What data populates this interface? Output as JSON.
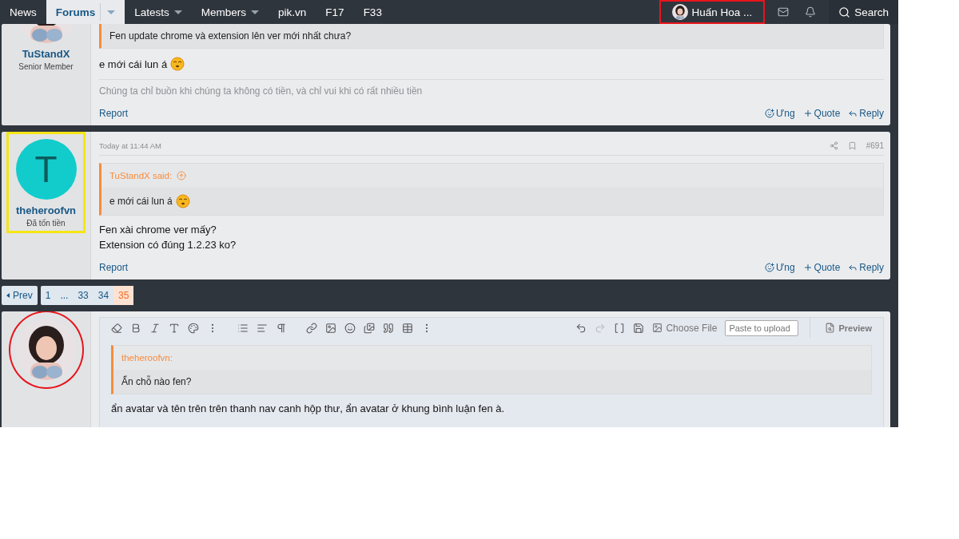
{
  "nav": {
    "items": [
      {
        "label": "News",
        "selected": false,
        "dropdown": false
      },
      {
        "label": "Forums",
        "selected": true,
        "dropdown": true
      },
      {
        "label": "Latests",
        "selected": false,
        "dropdown": true
      },
      {
        "label": "Members",
        "selected": false,
        "dropdown": true
      },
      {
        "label": "pik.vn",
        "selected": false,
        "dropdown": false
      },
      {
        "label": "F17",
        "selected": false,
        "dropdown": false
      },
      {
        "label": "F33",
        "selected": false,
        "dropdown": false
      }
    ],
    "user_menu": {
      "name": "Huấn Hoa ...",
      "highlight": {
        "color": "#e8141c"
      }
    },
    "search": "Search"
  },
  "posts": [
    {
      "author": "TuStandX",
      "role": "Senior Member",
      "avatar": {
        "kind": "picture"
      },
      "cut_top": true,
      "quote": {
        "text": "Fen update chrome và extension lên ver mới nhất chưa?",
        "emoji": false
      },
      "body": [
        {
          "text": "e mới cái lun á",
          "emoji": true
        }
      ],
      "signature": "Chúng ta chỉ buồn khi chúng ta không có tiền, và chỉ vui khi có rất nhiều tiền",
      "report": "Report",
      "actions": [
        "Ưng",
        "Quote",
        "Reply"
      ]
    },
    {
      "author": "theheroofvn",
      "role": "Đã tốn tiền",
      "avatar": {
        "kind": "letter",
        "letter": "T",
        "color": "#12cccc"
      },
      "highlight": {
        "color": "#f5e614"
      },
      "cut_top": false,
      "date": "Today at 11:44 AM",
      "number": "#691",
      "quote": {
        "author": "TuStandX said:",
        "text": "e mới cái lun á",
        "emoji": true
      },
      "body": [
        {
          "text": "Fen xài chrome ver mấy?",
          "emoji": false
        },
        {
          "text": "Extension có đúng 1.2.23 ko?",
          "emoji": false
        }
      ],
      "report": "Report",
      "actions": [
        "Ưng",
        "Quote",
        "Reply"
      ]
    }
  ],
  "pagination": {
    "prev": "Prev",
    "pages": [
      {
        "label": "1",
        "selected": false
      },
      {
        "label": "...",
        "selected": false
      },
      {
        "label": "33",
        "selected": false
      },
      {
        "label": "34",
        "selected": false
      },
      {
        "label": "35",
        "selected": true
      }
    ]
  },
  "editor": {
    "avatar": {
      "kind": "picture"
    },
    "highlight": {
      "color": "#e8141c"
    },
    "redo_disabled": true,
    "choose_file": "Choose File",
    "paste_placeholder": "Paste to upload",
    "preview": "Preview",
    "quote": {
      "author": "theheroofvn:",
      "text": "Ẩn chỗ nào fen?"
    },
    "text": "ẩn avatar và tên trên trên thanh nav canh hộp thư, ẩn avatar ở khung bình luận fen à."
  }
}
